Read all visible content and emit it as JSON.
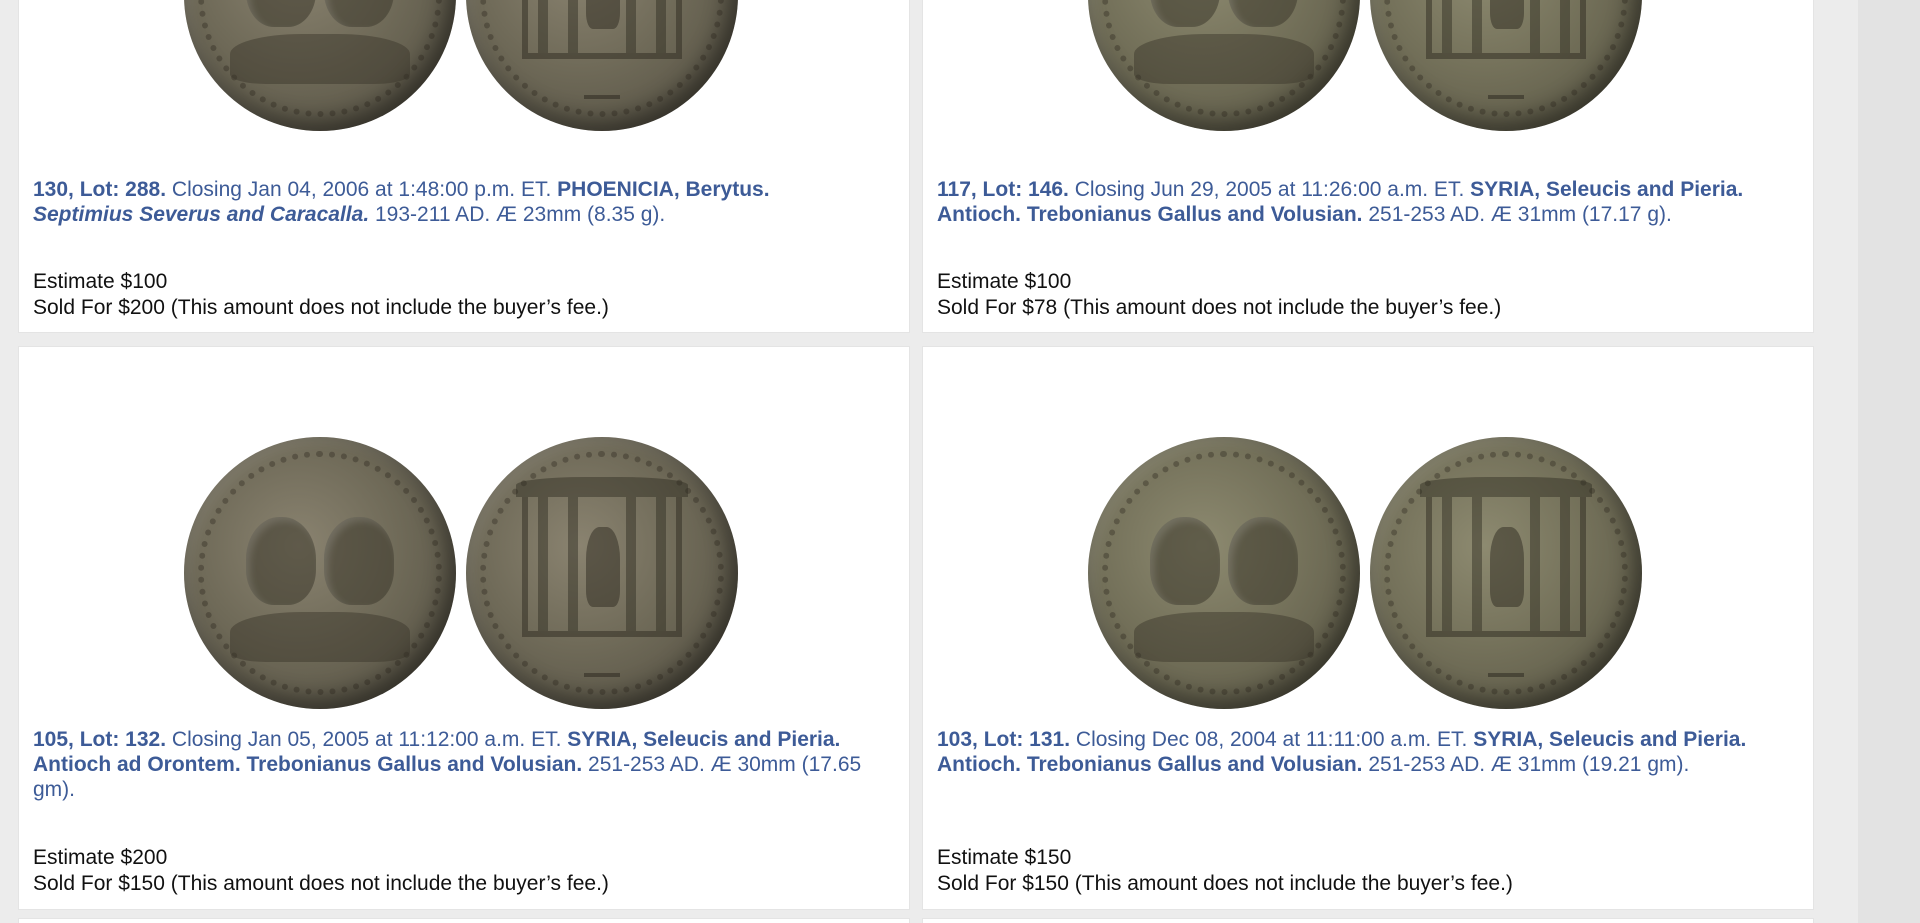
{
  "lots": [
    {
      "id": "130",
      "lot": "288",
      "lot_label": "130, Lot: 288.",
      "closing": "Closing Jan 04, 2006 at 1:48:00 p.m. ET.",
      "title_region": "PHOENICIA, Berytus.",
      "title_ruler": "Septimius Severus and Caracalla.",
      "details": "193-211 AD. Æ 23mm (8.35 g).",
      "estimate": "Estimate $100",
      "sold": "Sold For $200 (This amount does not include the buyer’s fee.)",
      "coin_tone": "bronze"
    },
    {
      "id": "117",
      "lot": "146",
      "lot_label": "117, Lot: 146.",
      "closing": "Closing Jun 29, 2005 at 11:26:00 a.m. ET.",
      "title_region": "SYRIA, Seleucis and Pieria.",
      "title_ruler": "Antioch. Trebonianus Gallus and Volusian.",
      "details": "251-253 AD. Æ 31mm (17.17 g).",
      "estimate": "Estimate $100",
      "sold": "Sold For $78 (This amount does not include the buyer’s fee.)",
      "coin_tone": "olive"
    },
    {
      "id": "105",
      "lot": "132",
      "lot_label": "105, Lot: 132.",
      "closing": "Closing Jan 05, 2005 at 11:12:00 a.m. ET.",
      "title_region": "SYRIA, Seleucis and Pieria.",
      "title_ruler": "Antioch ad Orontem. Trebonianus Gallus and Volusian.",
      "details": "251-253 AD. Æ 30mm (17.65 gm).",
      "estimate": "Estimate $200",
      "sold": "Sold For $150 (This amount does not include the buyer’s fee.)",
      "coin_tone": "bronze"
    },
    {
      "id": "103",
      "lot": "131",
      "lot_label": "103, Lot: 131.",
      "closing": "Closing Dec 08, 2004 at 11:11:00 a.m. ET.",
      "title_region": "SYRIA, Seleucis and Pieria.",
      "title_ruler": "Antioch. Trebonianus Gallus and Volusian.",
      "details": "251-253 AD. Æ 31mm (19.21 gm).",
      "estimate": "Estimate $150",
      "sold": "Sold For $150 (This amount does not include the buyer’s fee.)",
      "coin_tone": "olive"
    }
  ],
  "colors": {
    "link_blue": "#3d5b97",
    "text": "#111111",
    "page_bg": "#ececec",
    "card_bg": "#ffffff"
  }
}
